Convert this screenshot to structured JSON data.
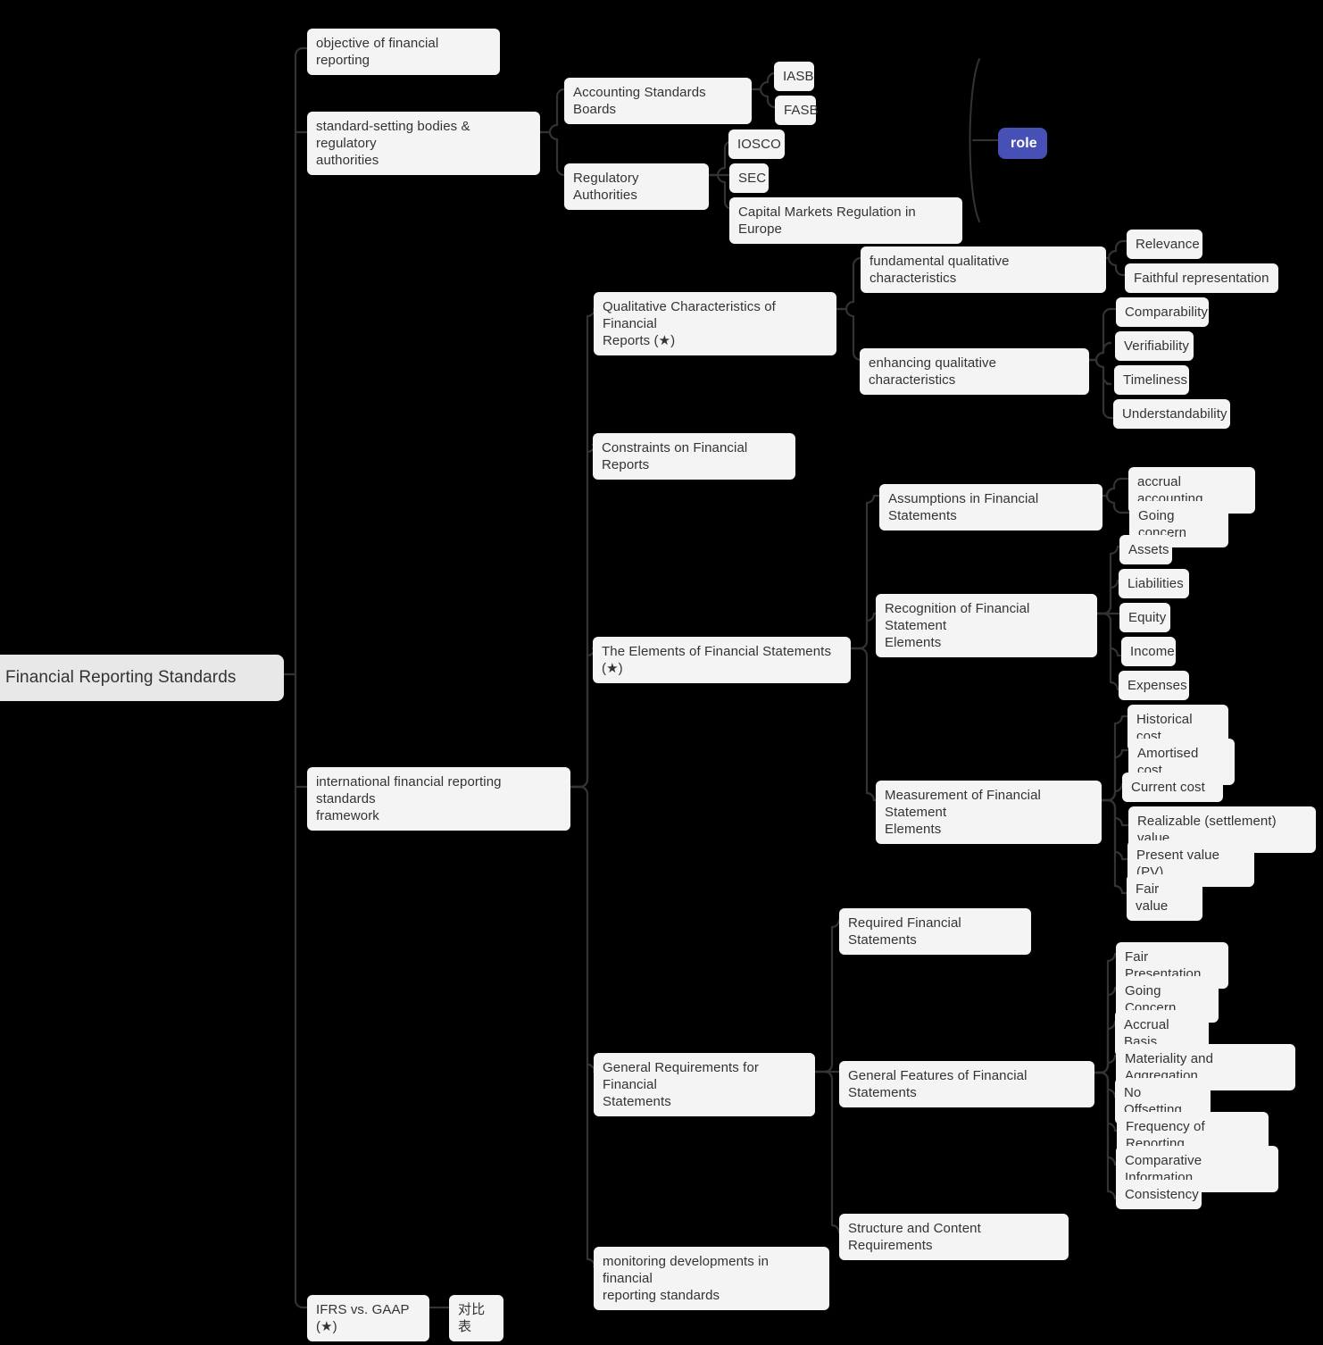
{
  "diagram": {
    "type": "mindmap",
    "title": "Financial Reporting Standards",
    "background": "#000000",
    "node_fill": "#f4f4f4",
    "root_fill": "#e8e8e8",
    "badge_fill": "#4750b4",
    "text_color": "#333333",
    "link_color": "#333333"
  },
  "nodes": {
    "root": "Financial Reporting Standards",
    "objective": "objective of financial reporting",
    "standard_setting": "standard-setting bodies & regulatory\nauthorities",
    "accounting_standards_boards": "Accounting Standards Boards",
    "iasb": "IASB",
    "fasb": "FASB",
    "regulatory_authorities": "Regulatory Authorities",
    "iosco": "IOSCO",
    "sec": "SEC",
    "capital_markets_europe": "Capital Markets Regulation in Europe",
    "role_badge": "role",
    "ifrs_framework": "international financial reporting standards\nframework",
    "qualitative_characteristics": "Qualitative Characteristics of Financial\nReports (★)",
    "fundamental_qc": "fundamental qualitative characteristics",
    "relevance": "Relevance",
    "faithful_representation": "Faithful representation",
    "enhancing_qc": "enhancing qualitative characteristics",
    "comparability": "Comparability",
    "verifiability": "Verifiability",
    "timeliness": "Timeliness",
    "understandability": "Understandability",
    "constraints": "Constraints on Financial Reports",
    "elements": "The Elements of Financial Statements (★)",
    "assumptions": "Assumptions in Financial Statements",
    "accrual_accounting": "accrual accounting",
    "going_concern_assumption": "Going concern",
    "recognition": "Recognition of Financial Statement\nElements",
    "assets": "Assets",
    "liabilities": "Liabilities",
    "equity": "Equity",
    "income": "Income",
    "expenses": "Expenses",
    "measurement": "Measurement of Financial Statement\nElements",
    "historical_cost": "Historical cost",
    "amortised_cost": "Amortised cost",
    "current_cost": "Current cost",
    "realizable_value": "Realizable (settlement) value",
    "present_value": "Present value (PV)",
    "fair_value": "Fair value",
    "general_requirements": "General Requirements for Financial\nStatements",
    "required_statements": "Required Financial Statements",
    "general_features": "General Features of Financial Statements",
    "fair_presentation": "Fair Presentation",
    "going_concern_feature": "Going Concern",
    "accrual_basis": "Accrual Basis",
    "materiality": "Materiality and Aggregation",
    "no_offsetting": "No Offsetting",
    "frequency": "Frequency of Reporting",
    "comparative_information": "Comparative Information",
    "consistency": "Consistency",
    "structure_content": "Structure and Content Requirements",
    "monitoring": "monitoring developments in financial\nreporting standards",
    "ifrs_vs_gaap": "IFRS vs. GAAP (★)",
    "comparison_table": "对比表"
  }
}
